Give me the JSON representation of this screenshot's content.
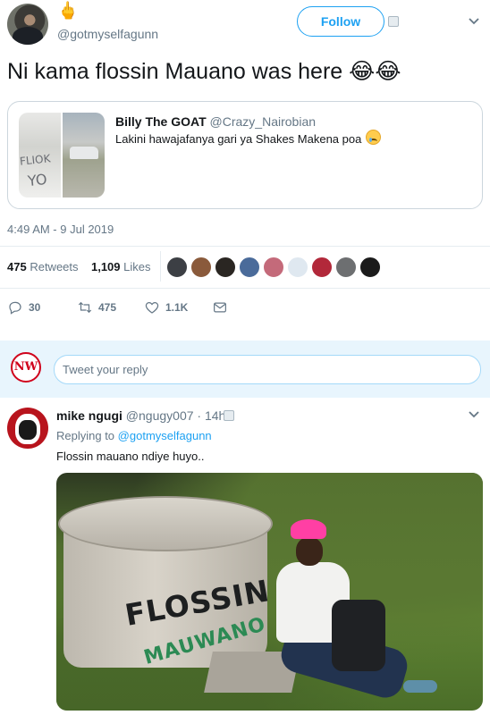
{
  "header": {
    "handle": "@gotmyselfagunn",
    "emoji": "🖕",
    "follow_label": "Follow"
  },
  "tweet": {
    "text": "Ni kama flossin Mauano was here 😂😂",
    "timestamp": "4:49 AM - 9 Jul 2019"
  },
  "quoted_tweet": {
    "name": "Billy The GOAT",
    "handle": "@Crazy_Nairobian",
    "text": "Lakini hawajafanya gari ya Shakes Makena poa",
    "image_text_line1": "FLIOK",
    "image_text_line2": "YO"
  },
  "stats": {
    "retweets_count": "475",
    "retweets_label": "Retweets",
    "likes_count": "1,109",
    "likes_label": "Likes",
    "liker_colors": [
      "#3c3f44",
      "#8a5a3b",
      "#2a2622",
      "#4a6b9a",
      "#c46a7a",
      "#dfe8f0",
      "#b2283a",
      "#6d6f71",
      "#1b1b1b"
    ]
  },
  "actions": {
    "replies": "30",
    "retweets": "475",
    "likes": "1.1K"
  },
  "reply_box": {
    "logo_text": "NW",
    "placeholder": "Tweet your reply"
  },
  "reply": {
    "name": "mike ngugi",
    "handle": "@ngugy007",
    "separator": "·",
    "time": "14h",
    "replying_prefix": "Replying to",
    "replying_to": "@gotmyselfagunn",
    "text": "Flossin mauano ndiye huyo..",
    "photo_text_line1": "FLOSSIN",
    "photo_text_line2": "MAUWANO"
  },
  "colors": {
    "accent": "#1da1f2",
    "muted": "#657786",
    "reply_band": "#e8f5fd"
  }
}
